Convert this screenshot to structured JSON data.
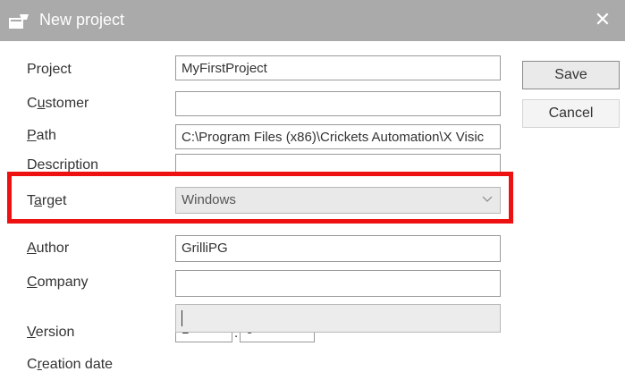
{
  "window": {
    "title": "New project",
    "close_glyph": "✕",
    "icon": "new-project-icon"
  },
  "form": {
    "project": {
      "label_pre": "Project",
      "label_ul": "",
      "label_post": "",
      "value": "MyFirstProject"
    },
    "customer": {
      "label_pre": "C",
      "label_ul": "u",
      "label_post": "stomer",
      "value": ""
    },
    "path": {
      "label_pre": "",
      "label_ul": "P",
      "label_post": "ath",
      "value": "C:\\Program Files (x86)\\Crickets Automation\\X Visic"
    },
    "description": {
      "label_pre": "Description",
      "label_ul": "",
      "label_post": "",
      "value": ""
    },
    "target": {
      "label_pre": "T",
      "label_ul": "a",
      "label_post": "rget",
      "value": "Windows"
    },
    "author": {
      "label_pre": "",
      "label_ul": "A",
      "label_post": "uthor",
      "value": "GrilliPG"
    },
    "company": {
      "label_pre": "",
      "label_ul": "C",
      "label_post": "ompany",
      "value": ""
    },
    "version": {
      "label_pre": "",
      "label_ul": "V",
      "label_post": "ersion",
      "major": "1",
      "separator": ".",
      "minor": "0"
    },
    "creation_date": {
      "label_pre": "C",
      "label_ul": "r",
      "label_post": "eation date",
      "value": ""
    }
  },
  "buttons": {
    "save": "Save",
    "cancel": "Cancel"
  },
  "colors": {
    "titlebar": "#aaaaaa",
    "highlight": "#ee1111"
  }
}
